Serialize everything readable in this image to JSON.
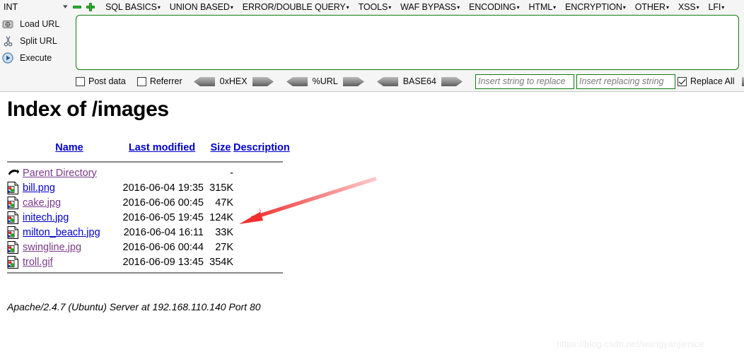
{
  "hackbar": {
    "type_selector": {
      "value": "INT",
      "icon": "chevron-down-icon"
    },
    "remove_button_label": "−",
    "add_button_label": "+",
    "menus": [
      {
        "label": "SQL BASICS",
        "caret": "▾"
      },
      {
        "label": "UNION BASED",
        "caret": "▾"
      },
      {
        "label": "ERROR/DOUBLE QUERY",
        "caret": "▾"
      },
      {
        "label": "TOOLS",
        "caret": "▾"
      },
      {
        "label": "WAF BYPASS",
        "caret": "▾"
      },
      {
        "label": "ENCODING",
        "caret": "▾"
      },
      {
        "label": "HTML",
        "caret": "▾"
      },
      {
        "label": "ENCRYPTION",
        "caret": "▾"
      },
      {
        "label": "OTHER",
        "caret": "▾"
      },
      {
        "label": "XSS",
        "caret": "▾"
      },
      {
        "label": "LFI",
        "caret": "▾"
      }
    ],
    "actions": [
      {
        "label": "Load URL",
        "icon": "load-url-icon"
      },
      {
        "label": "Split URL",
        "icon": "scissors-icon"
      },
      {
        "label": "Execute",
        "icon": "play-circle-icon"
      }
    ],
    "url_textarea": {
      "value": "",
      "placeholder": ""
    },
    "checkboxes": [
      {
        "label": "Post data",
        "checked": false
      },
      {
        "label": "Referrer",
        "checked": false
      }
    ],
    "encoders": [
      {
        "label": "0xHEX",
        "decode_icon": "arrow-left-icon",
        "encode_icon": "arrow-right-icon"
      },
      {
        "label": "%URL",
        "decode_icon": "arrow-left-icon",
        "encode_icon": "arrow-right-icon"
      },
      {
        "label": "BASE64",
        "decode_icon": "arrow-left-icon",
        "encode_icon": "arrow-right-icon"
      }
    ],
    "replace": {
      "search_value": "",
      "search_placeholder": "Insert string to replace",
      "replace_value": "",
      "replace_placeholder": "Insert replacing string",
      "replace_all_label": "Replace All",
      "replace_all_checked": true,
      "go_icon": "arrow-right-icon"
    }
  },
  "index_page": {
    "title": "Index of /images",
    "columns": [
      {
        "key": "name",
        "label": "Name"
      },
      {
        "key": "last_modified",
        "label": "Last modified"
      },
      {
        "key": "size",
        "label": "Size"
      },
      {
        "key": "description",
        "label": "Description"
      }
    ],
    "parent": {
      "name": "Parent Directory",
      "last_modified": "",
      "size": "-",
      "description": "",
      "icon": "back-arrow-icon",
      "visited": true
    },
    "files": [
      {
        "name": "bill.png",
        "last_modified": "2016-06-04 19:35",
        "size": "315K",
        "description": "",
        "icon": "image-file-icon",
        "visited": false
      },
      {
        "name": "cake.jpg",
        "last_modified": "2016-06-06 00:45",
        "size": "47K",
        "description": "",
        "icon": "image-file-icon",
        "visited": true
      },
      {
        "name": "initech.jpg",
        "last_modified": "2016-06-05 19:45",
        "size": "124K",
        "description": "",
        "icon": "image-file-icon",
        "visited": false
      },
      {
        "name": "milton_beach.jpg",
        "last_modified": "2016-06-04 16:11",
        "size": "33K",
        "description": "",
        "icon": "image-file-icon",
        "visited": false
      },
      {
        "name": "swingline.jpg",
        "last_modified": "2016-06-06 00:44",
        "size": "27K",
        "description": "",
        "icon": "image-file-icon",
        "visited": true
      },
      {
        "name": "troll.gif",
        "last_modified": "2016-06-09 13:45",
        "size": "354K",
        "description": "",
        "icon": "image-file-icon",
        "visited": true
      }
    ],
    "server_signature": "Apache/2.4.7 (Ubuntu) Server at 192.168.110.140 Port 80"
  },
  "annotation": {
    "arrow_color": "#f03030",
    "arrow_from": "530,252",
    "arrow_to": "340,317"
  },
  "watermark": {
    "text": "https://blog.csdn.net/wangyanjienice"
  },
  "colors": {
    "link_new": "#0000cc",
    "link_visited": "#7a3a8c",
    "toolbar_bg": "#f5f5f5",
    "field_border_green": "#107c10",
    "plus_green": "#2fb62f"
  }
}
